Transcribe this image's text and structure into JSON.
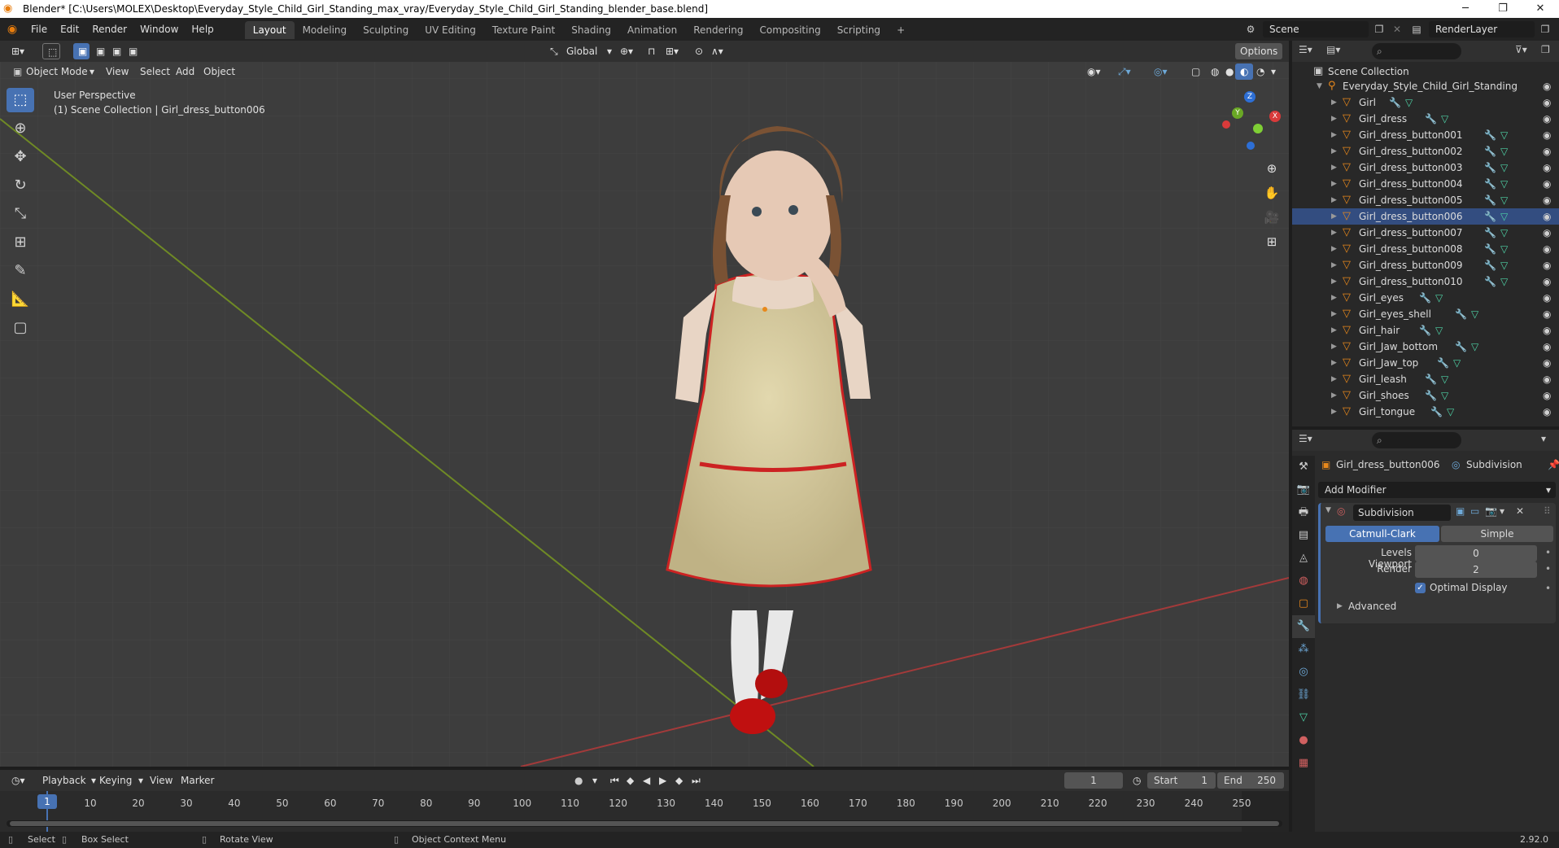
{
  "window": {
    "title": "Blender* [C:\\Users\\MOLEX\\Desktop\\Everyday_Style_Child_Girl_Standing_max_vray/Everyday_Style_Child_Girl_Standing_blender_base.blend]",
    "minimize": "─",
    "maximize": "❐",
    "close": "✕"
  },
  "menus": [
    "File",
    "Edit",
    "Render",
    "Window",
    "Help"
  ],
  "workspaces": [
    "Layout",
    "Modeling",
    "Sculpting",
    "UV Editing",
    "Texture Paint",
    "Shading",
    "Animation",
    "Rendering",
    "Compositing",
    "Scripting",
    "+"
  ],
  "scene": {
    "name": "Scene",
    "view_layer": "RenderLayer"
  },
  "viewport_header": {
    "transform_orientation": "Global",
    "options": "Options",
    "mode": "Object Mode",
    "menus": [
      "View",
      "Select",
      "Add",
      "Object"
    ]
  },
  "viewport": {
    "perspective": "User Perspective",
    "collection_info": "(1) Scene Collection | Girl_dress_button006",
    "gizmo": {
      "x": "X",
      "y": "Y",
      "z": "Z"
    }
  },
  "outliner": {
    "search_placeholder": "",
    "root": "Scene Collection",
    "collection": "Everyday_Style_Child_Girl_Standing",
    "objects": [
      "Girl",
      "Girl_dress",
      "Girl_dress_button001",
      "Girl_dress_button002",
      "Girl_dress_button003",
      "Girl_dress_button004",
      "Girl_dress_button005",
      "Girl_dress_button006",
      "Girl_dress_button007",
      "Girl_dress_button008",
      "Girl_dress_button009",
      "Girl_dress_button010",
      "Girl_eyes",
      "Girl_eyes_shell",
      "Girl_hair",
      "Girl_Jaw_bottom",
      "Girl_Jaw_top",
      "Girl_leash",
      "Girl_shoes",
      "Girl_tongue"
    ],
    "selected": "Girl_dress_button006"
  },
  "properties": {
    "object_name": "Girl_dress_button006",
    "modifier_context": "Subdivision",
    "add_modifier": "Add Modifier",
    "modifier": {
      "name": "Subdivision",
      "algorithms": [
        "Catmull-Clark",
        "Simple"
      ],
      "active_algorithm": "Catmull-Clark",
      "levels_viewport_label": "Levels Viewport",
      "levels_viewport": "0",
      "render_label": "Render",
      "render": "2",
      "optimal_display_label": "Optimal Display",
      "advanced_label": "Advanced"
    }
  },
  "timeline": {
    "menus": [
      "Playback",
      "Keying",
      "View",
      "Marker"
    ],
    "current_frame": "1",
    "start_label": "Start",
    "start": "1",
    "end_label": "End",
    "end": "250",
    "ticks": [
      "1",
      "10",
      "20",
      "30",
      "40",
      "50",
      "60",
      "70",
      "80",
      "90",
      "100",
      "110",
      "120",
      "130",
      "140",
      "150",
      "160",
      "170",
      "180",
      "190",
      "200",
      "210",
      "220",
      "230",
      "240",
      "250"
    ]
  },
  "statusbar": {
    "select": "Select",
    "box_select": "Box Select",
    "rotate_view": "Rotate View",
    "context_menu": "Object Context Menu",
    "version": "2.92.0"
  },
  "colors": {
    "accent": "#4772b3",
    "object_orange": "#e8881b",
    "mesh_green": "#4fd3a7",
    "grid_x": "#a33a3a",
    "grid_y": "#6f8a25"
  }
}
